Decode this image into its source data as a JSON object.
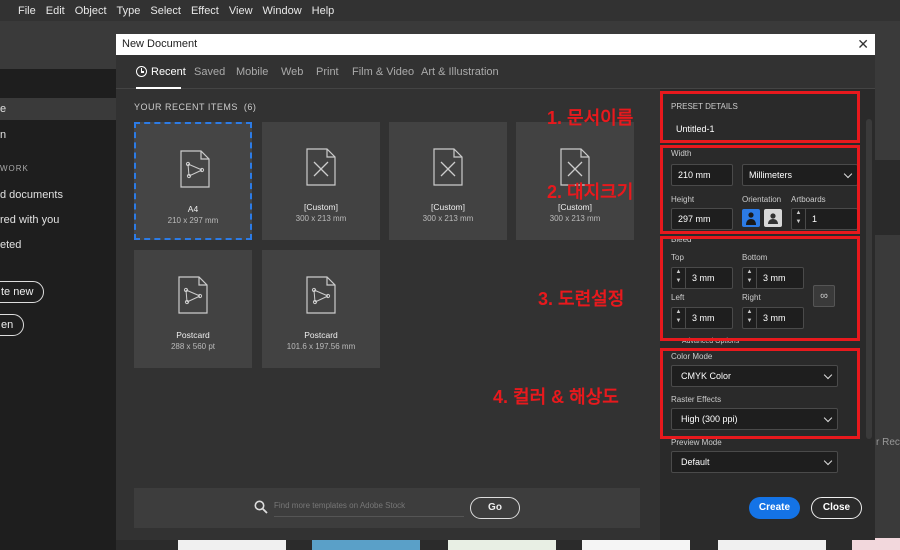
{
  "menubar": [
    "File",
    "Edit",
    "Object",
    "Type",
    "Select",
    "Effect",
    "View",
    "Window",
    "Help"
  ],
  "left_panel": {
    "items": [
      "e",
      "n"
    ],
    "section_head": "WORK",
    "links": [
      "d documents",
      "red with you",
      "eted"
    ],
    "create_button": "te new",
    "open_button": "en"
  },
  "right_bg_text": "r Rec",
  "dialog": {
    "title": "New Document",
    "tabs": [
      "Recent",
      "Saved",
      "Mobile",
      "Web",
      "Print",
      "Film & Video",
      "Art & Illustration"
    ],
    "recent_title": "YOUR RECENT ITEMS",
    "recent_count": "(6)",
    "cards": [
      {
        "name": "A4",
        "size": "210 x 297 mm",
        "icon": "brush-doc-icon"
      },
      {
        "name": "[Custom]",
        "size": "300 x 213 mm",
        "icon": "x-doc-icon"
      },
      {
        "name": "[Custom]",
        "size": "300 x 213 mm",
        "icon": "x-doc-icon"
      },
      {
        "name": "[Custom]",
        "size": "300 x 213 mm",
        "icon": "x-doc-icon"
      },
      {
        "name": "Postcard",
        "size": "288 x 560 pt",
        "icon": "brush-doc-icon"
      },
      {
        "name": "Postcard",
        "size": "101.6 x 197.56 mm",
        "icon": "brush-doc-icon"
      }
    ],
    "search_placeholder": "Find more templates on Adobe Stock",
    "go_label": "Go",
    "create_label": "Create",
    "close_label": "Close"
  },
  "details": {
    "preset_title": "PRESET DETAILS",
    "doc_name": "Untitled-1",
    "width_label": "Width",
    "width_value": "210 mm",
    "units": "Millimeters",
    "height_label": "Height",
    "height_value": "297 mm",
    "orientation_label": "Orientation",
    "artboards_label": "Artboards",
    "artboards_value": "1",
    "bleed_label": "Bleed",
    "top_label": "Top",
    "top_value": "3 mm",
    "bottom_label": "Bottom",
    "bottom_value": "3 mm",
    "left_label": "Left",
    "left_value": "3 mm",
    "right_label": "Right",
    "right_value": "3 mm",
    "advanced_label": "Advanced Options",
    "color_mode_label": "Color Mode",
    "color_mode_value": "CMYK Color",
    "raster_label": "Raster Effects",
    "raster_value": "High (300 ppi)",
    "preview_label": "Preview Mode",
    "preview_value": "Default"
  },
  "annotations": [
    "1. 문서이름",
    "2. 대지크기",
    "3. 도련설정",
    "4. 컬러 & 해상도"
  ],
  "colors": {
    "accent": "#1473e6",
    "annotation": "#e8191d",
    "selection": "#2c7be5"
  }
}
